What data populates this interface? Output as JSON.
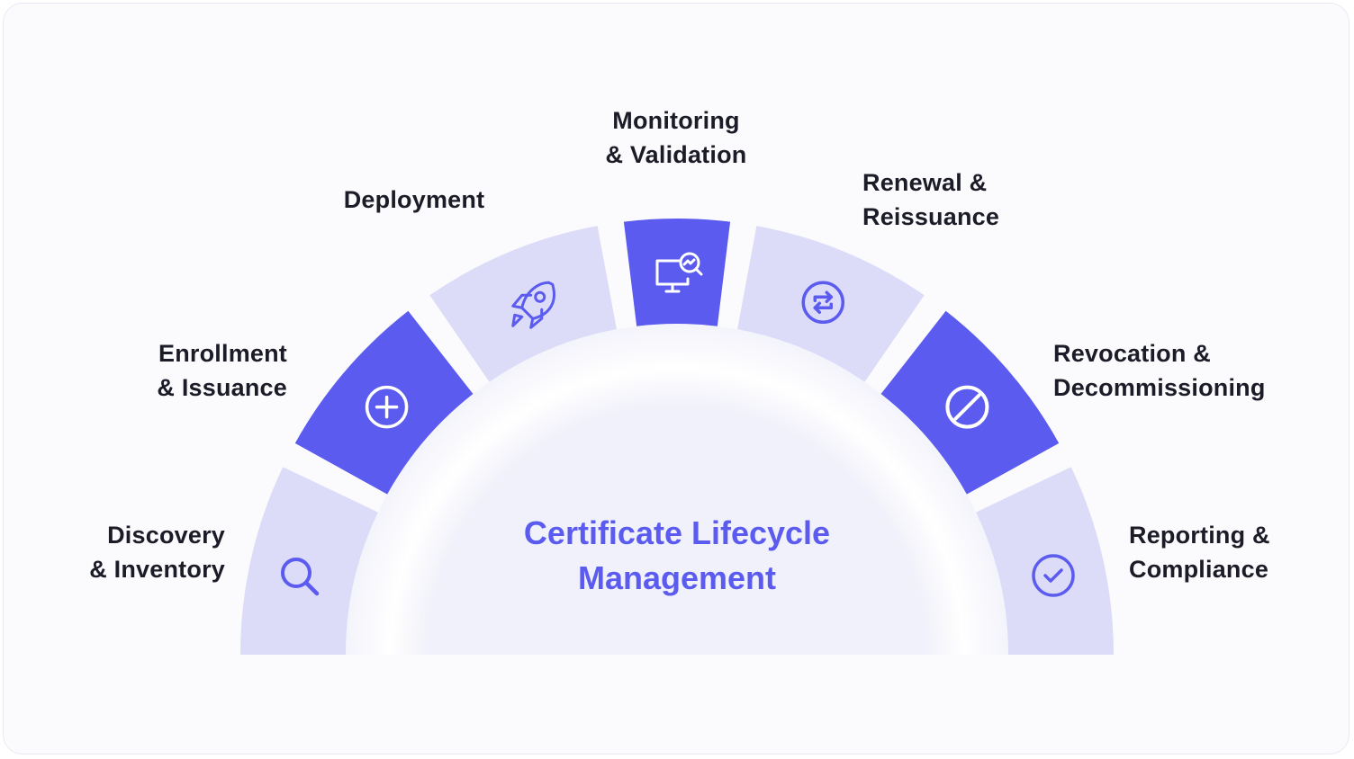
{
  "center": {
    "line1": "Certificate Lifecycle",
    "line2": "Management"
  },
  "stages": [
    {
      "line1": "Discovery",
      "line2": "& Inventory",
      "icon": "search-icon",
      "shade": "light"
    },
    {
      "line1": "Enrollment",
      "line2": "& Issuance",
      "icon": "plus-circle-icon",
      "shade": "dark"
    },
    {
      "line1": "Deployment",
      "line2": "",
      "icon": "rocket-icon",
      "shade": "light"
    },
    {
      "line1": "Monitoring",
      "line2": "& Validation",
      "icon": "monitor-search-icon",
      "shade": "dark"
    },
    {
      "line1": "Renewal &",
      "line2": "Reissuance",
      "icon": "refresh-icon",
      "shade": "light"
    },
    {
      "line1": "Revocation &",
      "line2": "Decommissioning",
      "icon": "block-icon",
      "shade": "dark"
    },
    {
      "line1": "Reporting &",
      "line2": "Compliance",
      "icon": "check-circle-icon",
      "shade": "light"
    }
  ],
  "colors": {
    "dark_segment": "#5b5cef",
    "light_segment": "#dcdcf9",
    "icon_on_light": "#5b5cef",
    "icon_on_dark": "#ffffff",
    "center_fill": "#f1f1fb",
    "text": "#1c1c28"
  }
}
